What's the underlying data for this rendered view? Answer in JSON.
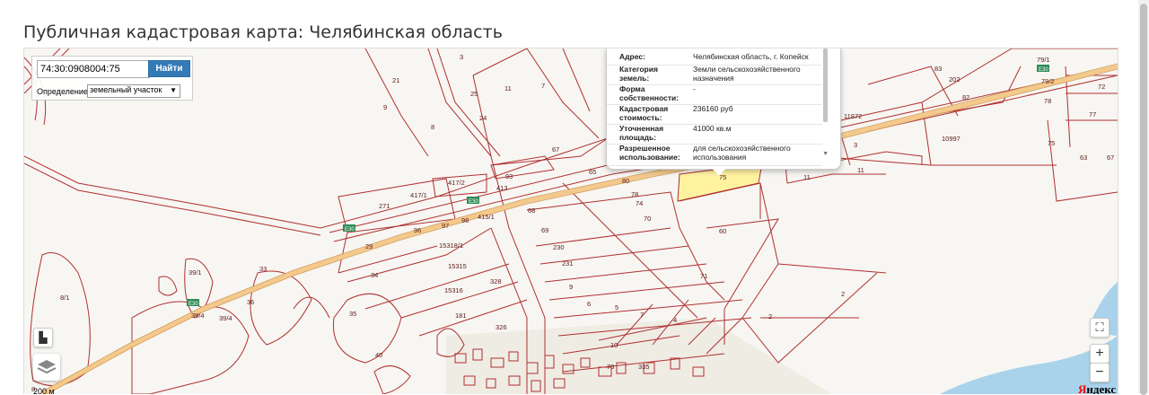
{
  "page": {
    "title": "Публичная кадастровая карта: Челябинская область"
  },
  "search": {
    "value": "74:30:0908004:75",
    "button_label": "Найти",
    "definition_label": "Определение:",
    "definition_value": "земельный участок"
  },
  "popup": {
    "rows": [
      {
        "key": "Адрес:",
        "value": "Челябинская область, г. Копейск"
      },
      {
        "key": "Категория земель:",
        "value": "Земли сельскохозяйственного назначения"
      },
      {
        "key": "Форма собственности:",
        "value": "-"
      },
      {
        "key": "Кадастровая стоимость:",
        "value": "236160 руб"
      },
      {
        "key": "Уточненная площадь:",
        "value": "41000 кв.м"
      },
      {
        "key": "Разрешенное использование:",
        "value": "для сельскохозяйственного использования"
      }
    ]
  },
  "map": {
    "road_labels": [
      "Е30",
      "Е30",
      "Е30",
      "Е30"
    ],
    "parcel_labels": [
      "3",
      "21",
      "9",
      "8",
      "25",
      "11",
      "7",
      "24",
      "67",
      "11872",
      "83",
      "82",
      "202",
      "79/1",
      "79/2",
      "72",
      "78",
      "77",
      "10997",
      "75",
      "63",
      "67",
      "3",
      "11",
      "11",
      "417/2",
      "413",
      "93",
      "417/1",
      "271",
      "65",
      "80",
      "75",
      "78",
      "74",
      "70",
      "68",
      "69",
      "60",
      "96",
      "97",
      "98",
      "415/1",
      "29",
      "15318/1",
      "230",
      "231",
      "15315",
      "34",
      "39/1",
      "33",
      "8/1",
      "36",
      "15316",
      "328",
      "9",
      "71",
      "6",
      "5",
      "7",
      "4",
      "2",
      "2",
      "35",
      "181",
      "326",
      "39/4",
      "39/4",
      "10",
      "40",
      "335",
      "73",
      "8"
    ],
    "scale": "200 м",
    "attribution_logo": "Я",
    "attribution_rest": "ндекс"
  },
  "controls": {
    "fullscreen_glyph": "⛶",
    "zoom_in": "+",
    "zoom_out": "−",
    "ruler_glyph": "▙"
  },
  "colors": {
    "parcel_line": "#b03030",
    "road_fill": "#f4c98c",
    "selected_parcel": "#fff3a0",
    "water": "#a9d3ea",
    "button": "#337ab7"
  }
}
